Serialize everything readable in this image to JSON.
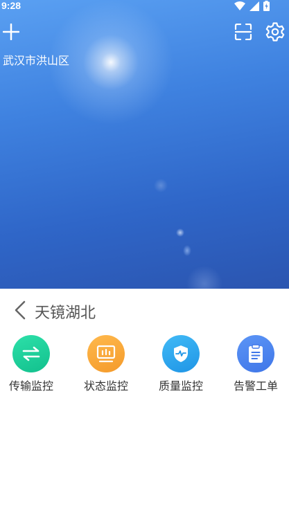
{
  "status_bar": {
    "time": "9:28"
  },
  "header": {
    "location": "武汉市洪山区",
    "add_icon": "plus-icon",
    "scan_icon": "scan-icon",
    "settings_icon": "gear-icon"
  },
  "panel": {
    "title": "天镜湖北",
    "back_icon": "chevron-left-icon"
  },
  "menu": {
    "items": [
      {
        "label": "传输监控",
        "icon": "transfer-arrows-icon",
        "color": "#1fcf9a"
      },
      {
        "label": "状态监控",
        "icon": "monitor-icon",
        "color": "#f8a93a"
      },
      {
        "label": "质量监控",
        "icon": "shield-pulse-icon",
        "color": "#2ea8f0"
      },
      {
        "label": "告警工单",
        "icon": "clipboard-icon",
        "color": "#4b86f0"
      }
    ]
  }
}
